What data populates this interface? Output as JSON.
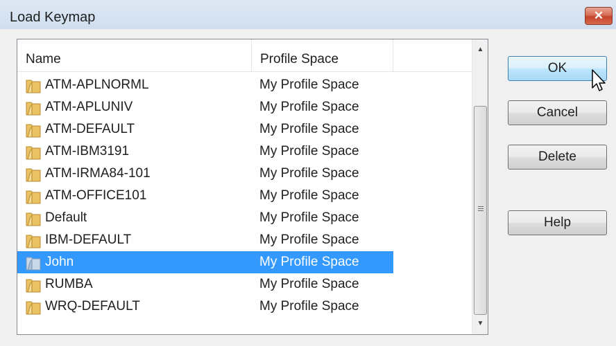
{
  "window": {
    "title": "Load Keymap",
    "close_glyph": "✕"
  },
  "list": {
    "columns": [
      "Name",
      "Profile Space"
    ],
    "rows": [
      {
        "name": "ATM-APLNORML",
        "space": "My Profile Space",
        "icon": "folder-icon",
        "selected": false
      },
      {
        "name": "ATM-APLUNIV",
        "space": "My Profile Space",
        "icon": "folder-icon",
        "selected": false
      },
      {
        "name": "ATM-DEFAULT",
        "space": "My Profile Space",
        "icon": "folder-icon",
        "selected": false
      },
      {
        "name": "ATM-IBM3191",
        "space": "My Profile Space",
        "icon": "folder-icon",
        "selected": false
      },
      {
        "name": "ATM-IRMA84-101",
        "space": "My Profile Space",
        "icon": "folder-icon",
        "selected": false
      },
      {
        "name": "ATM-OFFICE101",
        "space": "My Profile Space",
        "icon": "folder-icon",
        "selected": false
      },
      {
        "name": "Default",
        "space": "My Profile Space",
        "icon": "folder-icon",
        "selected": false
      },
      {
        "name": "IBM-DEFAULT",
        "space": "My Profile Space",
        "icon": "folder-icon",
        "selected": false
      },
      {
        "name": "John",
        "space": "My Profile Space",
        "icon": "folder-icon",
        "selected": true
      },
      {
        "name": "RUMBA",
        "space": "My Profile Space",
        "icon": "folder-icon",
        "selected": false
      },
      {
        "name": "WRQ-DEFAULT",
        "space": "My Profile Space",
        "icon": "folder-icon",
        "selected": false
      }
    ]
  },
  "buttons": {
    "ok": "OK",
    "cancel": "Cancel",
    "delete": "Delete",
    "help": "Help"
  },
  "colors": {
    "selection": "#3399ff",
    "folder": "#e6b84a",
    "close": "#c5432b"
  }
}
